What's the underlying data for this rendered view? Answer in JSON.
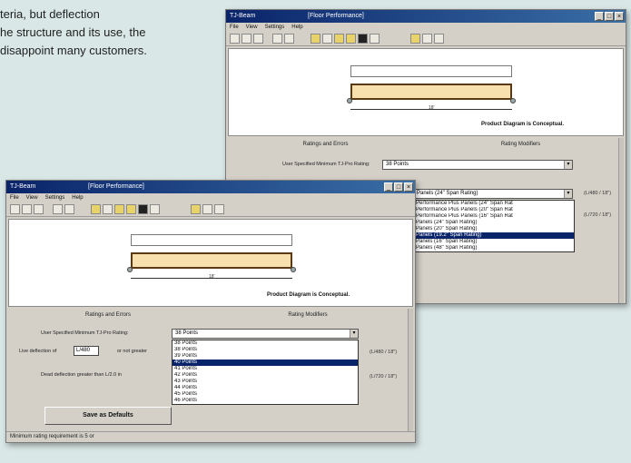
{
  "article": {
    "lines": [
      "teria, but deflection",
      "he structure and its use, the",
      "disappoint many customers."
    ]
  },
  "back_window": {
    "title": "TJ-Beam",
    "document": "[Floor Performance]",
    "controls": [
      "_",
      "□",
      "×"
    ],
    "menu": [
      "File",
      "View",
      "Settings",
      "Help"
    ],
    "diagram_caption": "Product Diagram is Conceptual.",
    "span_label": "18'",
    "tabs": [
      "Ratings and Errors",
      "Rating Modifiers"
    ],
    "user_spec_label": "User Specified Minimum TJ-Pro Rating:",
    "user_spec_value": "38 Points",
    "product_value": "Panels (24\" Span Rating)",
    "values": [
      "(L/480 / 18\")",
      "(L/720 / 18\")"
    ],
    "dropdown": [
      "Performance Plus Panels (24\" Span Rat",
      "Performance Plus Panels (20\" Span Rat",
      "Performance Plus Panels (16\" Span Rat",
      "Panels (24\" Span Rating)",
      "Panels (20\" Span Rating)",
      "Panels (19.2\" Span Rating)",
      "Panels (16\" Span Rating)",
      "Panels (48\" Span Rating)"
    ]
  },
  "front_window": {
    "title": "TJ-Beam",
    "document": "[Floor Performance]",
    "controls": [
      "_",
      "□",
      "×"
    ],
    "menu": [
      "File",
      "View",
      "Settings",
      "Help"
    ],
    "diagram_caption": "Product Diagram is Conceptual.",
    "span_label": "18'",
    "tabs": [
      "Ratings and Errors",
      "Rating Modifiers"
    ],
    "user_spec_label": "User Specified Minimum TJ-Pro Rating:",
    "user_spec_value": "38 Points",
    "deflection_label": "Live deflection of",
    "deflection_value": "L/480",
    "deflection_suffix": "or not greater",
    "dead_label": "Dead deflection greater than L/2.0 in",
    "values": [
      "(L/480 / 18\")",
      "(L/720 / 18\")"
    ],
    "dropdown": [
      "38 Points",
      "38 Points",
      "39 Points",
      "40 Points",
      "41 Points",
      "42 Points",
      "43 Points",
      "44 Points",
      "45 Points",
      "46 Points"
    ],
    "save_button": "Save as Defaults",
    "status": "Minimum rating requirement is 5 or"
  }
}
